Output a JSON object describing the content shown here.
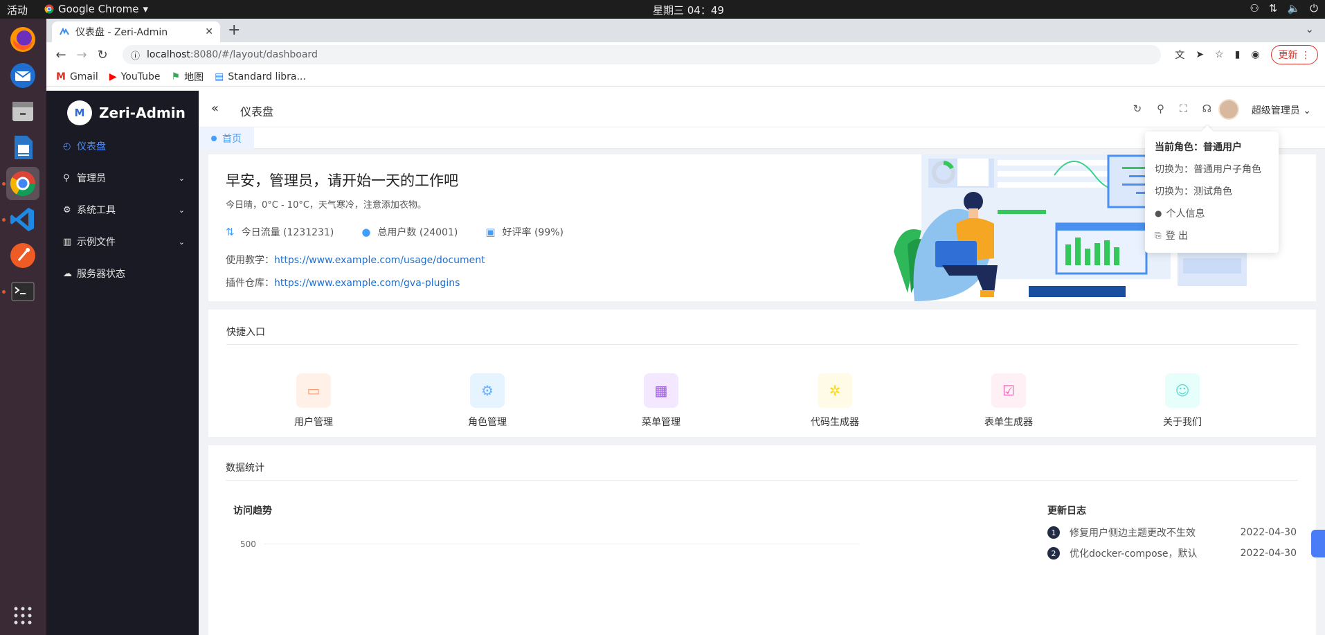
{
  "system": {
    "activities": "活动",
    "app_menu": "Google Chrome",
    "clock": "星期三 04：49"
  },
  "browser": {
    "tab_title": "仪表盘 - Zeri-Admin",
    "url_host": "localhost",
    "url_path": ":8080/#/layout/dashboard",
    "update_label": "更新",
    "bookmarks": [
      "Gmail",
      "YouTube",
      "地图",
      "Standard libra..."
    ]
  },
  "sidebar": {
    "logo_text": "Zeri-Admin",
    "logo_mark": "M",
    "items": [
      {
        "label": "仪表盘",
        "icon": "◴"
      },
      {
        "label": "管理员",
        "icon": "⚲"
      },
      {
        "label": "系统工具",
        "icon": "⚙"
      },
      {
        "label": "示例文件",
        "icon": "▥"
      },
      {
        "label": "服务器状态",
        "icon": "☁"
      }
    ]
  },
  "header": {
    "breadcrumb": "仪表盘",
    "username": "超级管理员"
  },
  "tags": {
    "home": "首页"
  },
  "welcome": {
    "greeting": "早安，管理员，请开始一天的工作吧",
    "weather": "今日晴，0°C - 10°C，天气寒冷，注意添加衣物。",
    "stats": [
      {
        "label": "今日流量 (1231231)"
      },
      {
        "label": "总用户数 (24001)"
      },
      {
        "label": "好评率 (99%)"
      }
    ],
    "tutorial_label": "使用教学：",
    "tutorial_link": "https://www.example.com/usage/document",
    "plugin_label": "插件仓库：",
    "plugin_link": "https://www.example.com/gva-plugins"
  },
  "quick": {
    "title": "快捷入口",
    "items": [
      {
        "label": "用户管理",
        "icon": "monitor-icon",
        "color": "#ff9c6e",
        "bg": "#fff0e8"
      },
      {
        "label": "角色管理",
        "icon": "gear-icon",
        "color": "#69b1ff",
        "bg": "#e6f4ff"
      },
      {
        "label": "菜单管理",
        "icon": "grid-icon",
        "color": "#9254de",
        "bg": "#f3e8ff"
      },
      {
        "label": "代码生成器",
        "icon": "cpu-icon",
        "color": "#fadb14",
        "bg": "#fffbe6"
      },
      {
        "label": "表单生成器",
        "icon": "document-check-icon",
        "color": "#f759ab",
        "bg": "#fff0f6"
      },
      {
        "label": "关于我们",
        "icon": "user-icon",
        "color": "#5cdbd3",
        "bg": "#e6fffb"
      }
    ]
  },
  "data_stats": {
    "title": "数据统计",
    "chart_title": "访问趋势",
    "y_tick": "500",
    "log_title": "更新日志",
    "log": [
      {
        "num": "1",
        "text": "修复用户侧边主题更改不生效",
        "date": "2022-04-30"
      },
      {
        "num": "2",
        "text": "优化docker-compose，默认",
        "date": "2022-04-30"
      }
    ]
  },
  "dropdown": {
    "current_role": "当前角色：普通用户",
    "switch_1": "切换为：普通用户子角色",
    "switch_2": "切换为：测试角色",
    "profile": "个人信息",
    "logout": "登 出"
  }
}
